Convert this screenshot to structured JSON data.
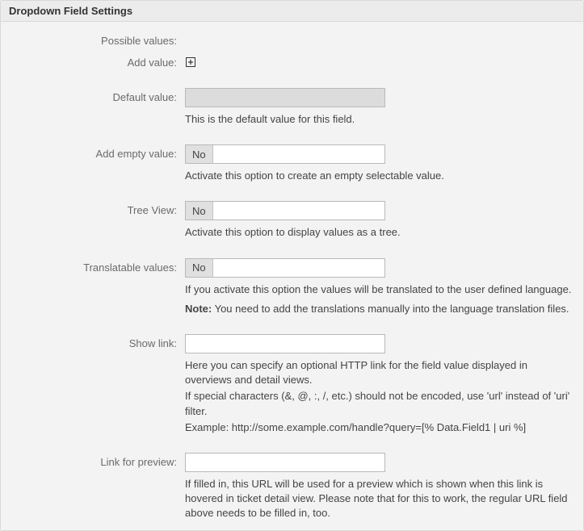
{
  "panel": {
    "title": "Dropdown Field Settings"
  },
  "fields": {
    "possible": {
      "label": "Possible values:"
    },
    "add_value": {
      "label": "Add value:"
    },
    "default_value": {
      "label": "Default value:",
      "value": "",
      "help": "This is the default value for this field."
    },
    "add_empty": {
      "label": "Add empty value:",
      "value": "No",
      "help": "Activate this option to create an empty selectable value."
    },
    "tree_view": {
      "label": "Tree View:",
      "value": "No",
      "help": "Activate this option to display values as a tree."
    },
    "translatable": {
      "label": "Translatable values:",
      "value": "No",
      "help": "If you activate this option the values will be translated to the user defined language.",
      "note_label": "Note:",
      "note_text": " You need to add the translations manually into the language translation files."
    },
    "show_link": {
      "label": "Show link:",
      "value": "",
      "help1": "Here you can specify an optional HTTP link for the field value displayed in overviews and detail views.",
      "help2": "If special characters (&, @, :, /, etc.) should not be encoded, use 'url' instead of 'uri' filter.",
      "help3": "Example: http://some.example.com/handle?query=[% Data.Field1 | uri %]"
    },
    "link_preview": {
      "label": "Link for preview:",
      "value": "",
      "help": "If filled in, this URL will be used for a preview which is shown when this link is hovered in ticket detail view. Please note that for this to work, the regular URL field above needs to be filled in, too."
    }
  }
}
